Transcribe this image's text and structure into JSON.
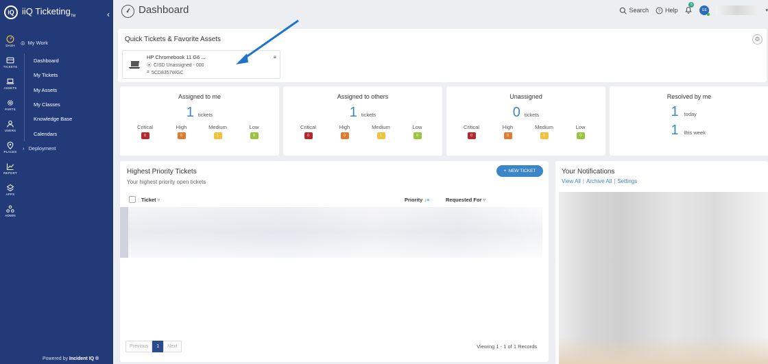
{
  "brand": {
    "name": "iiQ Ticketing",
    "tm": "TM"
  },
  "sidebar": {
    "rail": [
      {
        "label": "DASH",
        "icon": "dashboard-icon"
      },
      {
        "label": "TICKETS",
        "icon": "tickets-icon"
      },
      {
        "label": "ASSETS",
        "icon": "laptop-icon"
      },
      {
        "label": "PARTS",
        "icon": "gear-icon"
      },
      {
        "label": "USERS",
        "icon": "user-icon"
      },
      {
        "label": "PLACES",
        "icon": "map-pin-icon"
      },
      {
        "label": "REPORT",
        "icon": "chart-icon"
      },
      {
        "label": "APPS",
        "icon": "apps-icon"
      },
      {
        "label": "ADMIN",
        "icon": "admin-icon"
      }
    ],
    "my_work": "My Work",
    "items": [
      "Dashboard",
      "My Tickets",
      "My Assets",
      "My Classes",
      "Knowledge Base",
      "Calendars"
    ],
    "deployment": "Deployment",
    "powered_prefix": "Powered by",
    "powered_brand": "Incident IQ ®"
  },
  "header": {
    "title": "Dashboard",
    "search": "Search",
    "help": "Help",
    "notification_count": "6",
    "avatar_initials": "EE"
  },
  "quick": {
    "title": "Quick Tickets & Favorite Assets",
    "asset": {
      "name": "HP Chromebook 11 G6 ...",
      "location": "CISD Unassigned - 000",
      "tag": "5CD8357WGC"
    }
  },
  "stats": [
    {
      "title": "Assigned to me",
      "count": "1",
      "unit": "tickets",
      "prio": [
        "0",
        "0",
        "1",
        "0"
      ]
    },
    {
      "title": "Assigned to others",
      "count": "1",
      "unit": "tickets",
      "prio": [
        "0",
        "0",
        "1",
        "0"
      ]
    },
    {
      "title": "Unassigned",
      "count": "0",
      "unit": "tickets",
      "prio": [
        "0",
        "0",
        "0",
        "0"
      ]
    }
  ],
  "priority_labels": [
    "Critical",
    "High",
    "Medium",
    "Low"
  ],
  "resolved": {
    "title": "Resolved by me",
    "today_count": "1",
    "today_label": "today",
    "week_count": "1",
    "week_label": "this week"
  },
  "tickets": {
    "title": "Highest Priority Tickets",
    "subtitle": "Your highest priority open tickets",
    "new_button": "NEW TICKET",
    "col_ticket": "Ticket",
    "col_priority": "Priority",
    "col_requested": "Requested For",
    "prev": "Previous",
    "page": "1",
    "next": "Next",
    "viewing": "Viewing 1 - 1 of 1 Records"
  },
  "notifications": {
    "title": "Your Notifications",
    "view_all": "View All",
    "archive_all": "Archive All",
    "settings": "Settings"
  },
  "colors": {
    "sidebar": "#223a78",
    "accent": "#3b86c6",
    "critical": "#b4282c",
    "high": "#e07a2c",
    "medium": "#f3c23c",
    "low": "#9ac43d"
  }
}
